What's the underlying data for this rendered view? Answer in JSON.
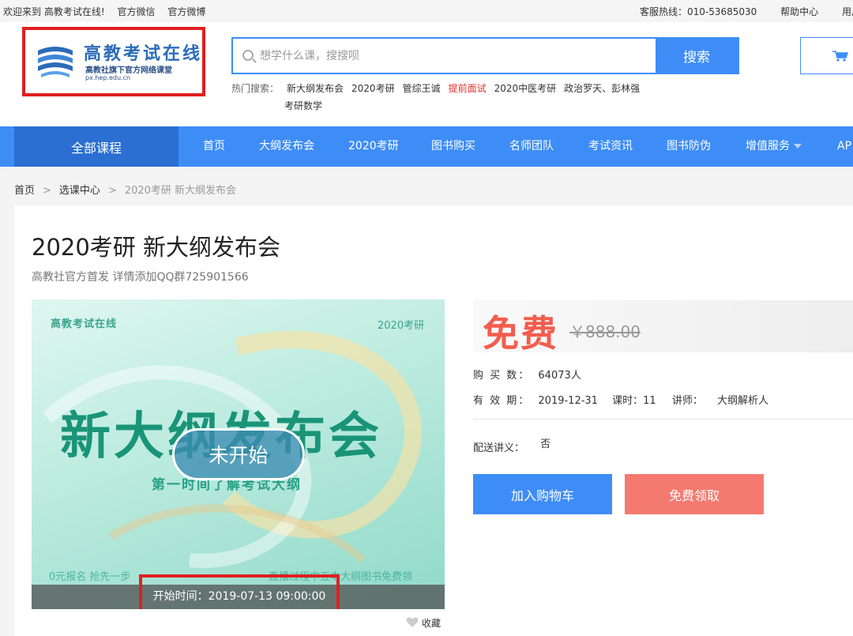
{
  "topbar": {
    "welcome": "欢迎来到 高教考试在线!",
    "wechat": "官方微信",
    "weibo": "官方微博",
    "hotline": "客服热线：010-53685030",
    "help": "帮助中心",
    "user": "用户"
  },
  "logo": {
    "title": "高教考试在线",
    "subtitle": "高教社旗下官方网络课堂",
    "url": "px.hep.edu.cn"
  },
  "search": {
    "placeholder": "想学什么课，搜搜呗",
    "button": "搜索",
    "hot_label": "热门搜索：",
    "hot_keywords": [
      "新大纲发布会",
      "2020考研",
      "管综王诚",
      "提前面试",
      "2020中医考研",
      "政治罗天、彭林强",
      "考研数学"
    ]
  },
  "nav": {
    "all_courses": "全部课程",
    "items": [
      "首页",
      "大纲发布会",
      "2020考研",
      "图书购买",
      "名师团队",
      "考试资讯",
      "图书防伪",
      "增值服务",
      "AP"
    ]
  },
  "breadcrumb": [
    "首页",
    "选课中心",
    "2020考研 新大纲发布会"
  ],
  "breadcrumb_sep": ">",
  "course": {
    "title": "2020考研 新大纲发布会",
    "subtitle": "高教社官方首发 详情添加QQ群725901566",
    "poster": {
      "logo": "高教考试在线",
      "year": "2020考研",
      "headline": "新大纲发布会",
      "sub": "第一时间了解考试大纲",
      "bottom_left": "0元报名 抢先一步",
      "bottom_right": "直播过程中五本大纲图书免费领",
      "status": "未开始",
      "start_time": "开始时间：2019-07-13 09:00:00"
    },
    "favorite": "收藏",
    "price_free": "免费",
    "price_original": "￥888.00",
    "buyers_label": "购 买 数：",
    "buyers": "64073人",
    "valid_label": "有 效 期：",
    "valid": "2019-12-31",
    "hours_label": "课时：",
    "hours": "11",
    "teacher_label": "讲师：",
    "teacher": "大纲解析人",
    "handout_label": "配送讲义：",
    "handout": "否",
    "add_cart": "加入购物车",
    "get_free": "免费领取"
  },
  "colors": {
    "primary": "#3e8df7",
    "primary_dark": "#2b6fd2",
    "price_red": "#f25d4d",
    "free_button": "#f47a70",
    "highlight_box": "#e02020",
    "poster_green": "#1a9478"
  },
  "icons": [
    "logo-book-icon",
    "search-icon",
    "cart-icon",
    "caret-down-icon",
    "heart-icon"
  ]
}
